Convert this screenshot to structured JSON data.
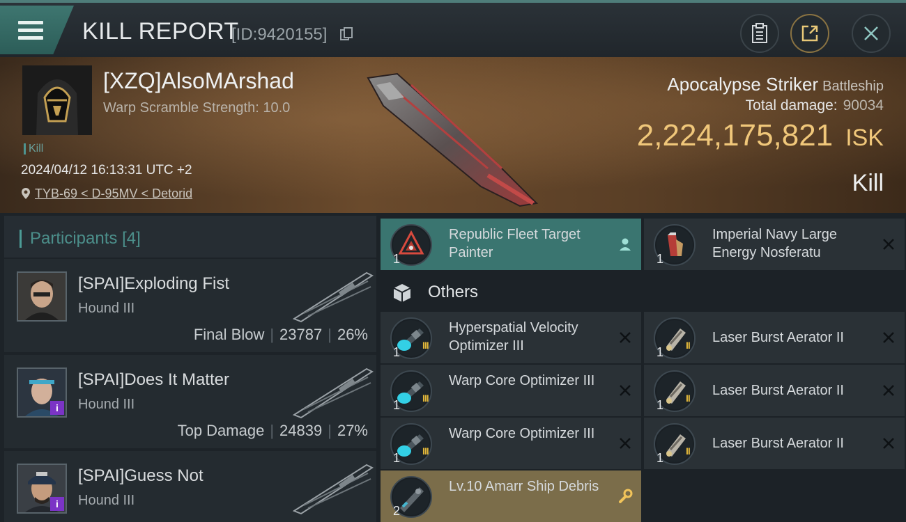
{
  "header": {
    "title": "KILL REPORT",
    "report_id": "[ID:9420155]",
    "icons": [
      "menu-icon",
      "copy-icon",
      "clipboard-icon",
      "share-icon",
      "close-icon"
    ]
  },
  "victim": {
    "name": "[XZQ]AlsoMArshad",
    "warp_scramble": "Warp Scramble Strength: 10.0",
    "tag": "Kill",
    "datetime": "2024/04/12 16:13:31 UTC +2",
    "location": "TYB-69 < D-95MV < Detorid"
  },
  "ship": {
    "name": "Apocalypse Striker",
    "class": "Battleship",
    "total_damage_label": "Total damage:",
    "total_damage": "90034",
    "isk_value": "2,224,175,821",
    "isk_unit": "ISK",
    "result": "Kill"
  },
  "participants": {
    "title": "Participants",
    "count": "[4]",
    "rows": [
      {
        "name": "[SPAI]Exploding Fist",
        "ship": "Hound III",
        "role": "Final Blow",
        "damage": "23787",
        "percent": "26%",
        "badge": ""
      },
      {
        "name": "[SPAI]Does It Matter",
        "ship": "Hound III",
        "role": "Top Damage",
        "damage": "24839",
        "percent": "27%",
        "badge": "i"
      },
      {
        "name": "[SPAI]Guess Not",
        "ship": "Hound III",
        "role": "",
        "damage": "",
        "percent": "",
        "badge": "i"
      }
    ]
  },
  "modules": {
    "top": [
      {
        "name": "Republic Fleet Target Painter",
        "qty": "1",
        "style": "teal",
        "action_icon": "person-icon"
      },
      {
        "name": "Imperial Navy Large Energy Nosferatu",
        "qty": "1",
        "style": "dark",
        "action_icon": "close-icon"
      }
    ],
    "others_label": "Others",
    "others": [
      {
        "name": "Hyperspatial Velocity Optimizer III",
        "qty": "1",
        "tier": "III",
        "style": "dark",
        "action_icon": "close-icon"
      },
      {
        "name": "Laser Burst Aerator II",
        "qty": "1",
        "tier": "II",
        "style": "dark",
        "action_icon": "close-icon"
      },
      {
        "name": "Warp Core Optimizer III",
        "qty": "1",
        "tier": "III",
        "style": "dark",
        "action_icon": "close-icon"
      },
      {
        "name": "Laser Burst Aerator II",
        "qty": "1",
        "tier": "II",
        "style": "dark",
        "action_icon": "close-icon"
      },
      {
        "name": "Warp Core Optimizer III",
        "qty": "1",
        "tier": "III",
        "style": "dark",
        "action_icon": "close-icon"
      },
      {
        "name": "Laser Burst Aerator II",
        "qty": "1",
        "tier": "II",
        "style": "dark",
        "action_icon": "close-icon"
      },
      {
        "name": "Lv.10 Amarr Ship Debris",
        "qty": "2",
        "tier": "",
        "style": "gold",
        "action_icon": "wrench-icon"
      }
    ]
  },
  "colors": {
    "accent_teal": "#3a7570",
    "isk_gold": "#f0c77a",
    "badge_purple": "#7b34c6"
  }
}
